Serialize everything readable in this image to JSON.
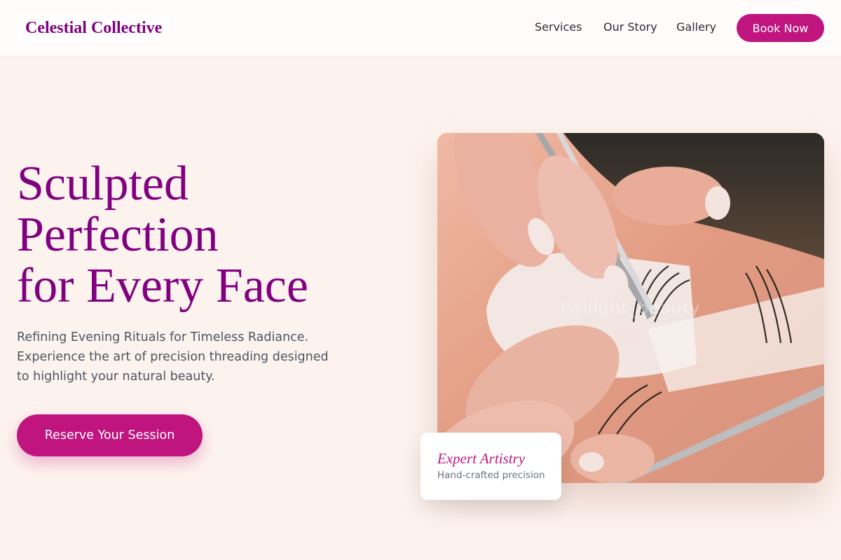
{
  "header": {
    "logo": "Celestial Collective",
    "nav": {
      "services": "Services",
      "our_story": "Our Story",
      "gallery": "Gallery"
    },
    "cta": "Book Now"
  },
  "hero": {
    "title_lines": [
      "Sculpted",
      "Perfection",
      "for Every Face"
    ],
    "subtitle_lines": [
      "Refining Evening Rituals for Timeless Radiance.",
      "Experience the art of precision threading designed",
      "to highlight your natural beauty."
    ],
    "cta": "Reserve Your Session",
    "image": {
      "description_icon": "eyelash-threading-photo",
      "watermark": "twilight_beauty"
    }
  },
  "card": {
    "title": "Expert Artistry",
    "subtitle": "Hand-crafted precision"
  },
  "colors": {
    "brand": "#800080",
    "accent": "#c0147f",
    "background": "#fdf3ee"
  }
}
